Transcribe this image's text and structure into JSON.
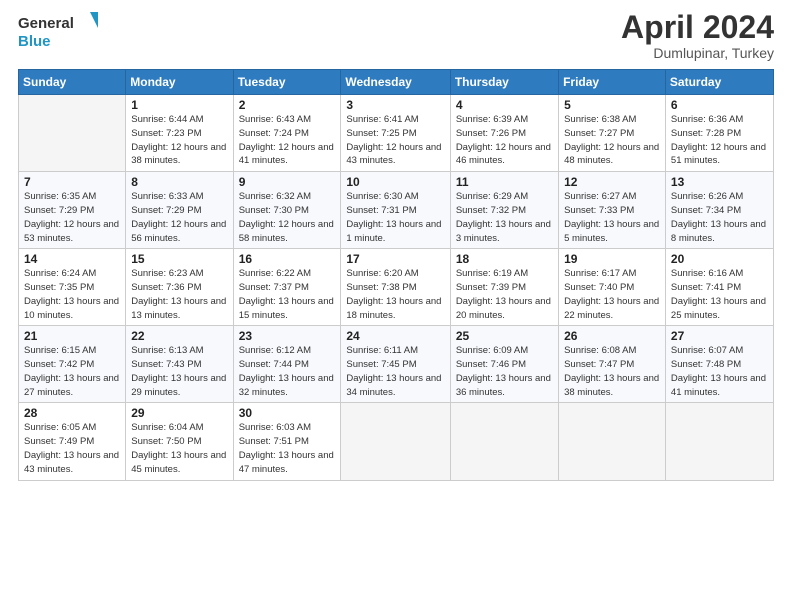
{
  "logo": {
    "line1": "General",
    "line2": "Blue"
  },
  "title": "April 2024",
  "subtitle": "Dumlupinar, Turkey",
  "headers": [
    "Sunday",
    "Monday",
    "Tuesday",
    "Wednesday",
    "Thursday",
    "Friday",
    "Saturday"
  ],
  "weeks": [
    [
      {
        "day": "",
        "sunrise": "",
        "sunset": "",
        "daylight": ""
      },
      {
        "day": "1",
        "sunrise": "6:44 AM",
        "sunset": "7:23 PM",
        "daylight": "12 hours and 38 minutes."
      },
      {
        "day": "2",
        "sunrise": "6:43 AM",
        "sunset": "7:24 PM",
        "daylight": "12 hours and 41 minutes."
      },
      {
        "day": "3",
        "sunrise": "6:41 AM",
        "sunset": "7:25 PM",
        "daylight": "12 hours and 43 minutes."
      },
      {
        "day": "4",
        "sunrise": "6:39 AM",
        "sunset": "7:26 PM",
        "daylight": "12 hours and 46 minutes."
      },
      {
        "day": "5",
        "sunrise": "6:38 AM",
        "sunset": "7:27 PM",
        "daylight": "12 hours and 48 minutes."
      },
      {
        "day": "6",
        "sunrise": "6:36 AM",
        "sunset": "7:28 PM",
        "daylight": "12 hours and 51 minutes."
      }
    ],
    [
      {
        "day": "7",
        "sunrise": "6:35 AM",
        "sunset": "7:29 PM",
        "daylight": "12 hours and 53 minutes."
      },
      {
        "day": "8",
        "sunrise": "6:33 AM",
        "sunset": "7:29 PM",
        "daylight": "12 hours and 56 minutes."
      },
      {
        "day": "9",
        "sunrise": "6:32 AM",
        "sunset": "7:30 PM",
        "daylight": "12 hours and 58 minutes."
      },
      {
        "day": "10",
        "sunrise": "6:30 AM",
        "sunset": "7:31 PM",
        "daylight": "13 hours and 1 minute."
      },
      {
        "day": "11",
        "sunrise": "6:29 AM",
        "sunset": "7:32 PM",
        "daylight": "13 hours and 3 minutes."
      },
      {
        "day": "12",
        "sunrise": "6:27 AM",
        "sunset": "7:33 PM",
        "daylight": "13 hours and 5 minutes."
      },
      {
        "day": "13",
        "sunrise": "6:26 AM",
        "sunset": "7:34 PM",
        "daylight": "13 hours and 8 minutes."
      }
    ],
    [
      {
        "day": "14",
        "sunrise": "6:24 AM",
        "sunset": "7:35 PM",
        "daylight": "13 hours and 10 minutes."
      },
      {
        "day": "15",
        "sunrise": "6:23 AM",
        "sunset": "7:36 PM",
        "daylight": "13 hours and 13 minutes."
      },
      {
        "day": "16",
        "sunrise": "6:22 AM",
        "sunset": "7:37 PM",
        "daylight": "13 hours and 15 minutes."
      },
      {
        "day": "17",
        "sunrise": "6:20 AM",
        "sunset": "7:38 PM",
        "daylight": "13 hours and 18 minutes."
      },
      {
        "day": "18",
        "sunrise": "6:19 AM",
        "sunset": "7:39 PM",
        "daylight": "13 hours and 20 minutes."
      },
      {
        "day": "19",
        "sunrise": "6:17 AM",
        "sunset": "7:40 PM",
        "daylight": "13 hours and 22 minutes."
      },
      {
        "day": "20",
        "sunrise": "6:16 AM",
        "sunset": "7:41 PM",
        "daylight": "13 hours and 25 minutes."
      }
    ],
    [
      {
        "day": "21",
        "sunrise": "6:15 AM",
        "sunset": "7:42 PM",
        "daylight": "13 hours and 27 minutes."
      },
      {
        "day": "22",
        "sunrise": "6:13 AM",
        "sunset": "7:43 PM",
        "daylight": "13 hours and 29 minutes."
      },
      {
        "day": "23",
        "sunrise": "6:12 AM",
        "sunset": "7:44 PM",
        "daylight": "13 hours and 32 minutes."
      },
      {
        "day": "24",
        "sunrise": "6:11 AM",
        "sunset": "7:45 PM",
        "daylight": "13 hours and 34 minutes."
      },
      {
        "day": "25",
        "sunrise": "6:09 AM",
        "sunset": "7:46 PM",
        "daylight": "13 hours and 36 minutes."
      },
      {
        "day": "26",
        "sunrise": "6:08 AM",
        "sunset": "7:47 PM",
        "daylight": "13 hours and 38 minutes."
      },
      {
        "day": "27",
        "sunrise": "6:07 AM",
        "sunset": "7:48 PM",
        "daylight": "13 hours and 41 minutes."
      }
    ],
    [
      {
        "day": "28",
        "sunrise": "6:05 AM",
        "sunset": "7:49 PM",
        "daylight": "13 hours and 43 minutes."
      },
      {
        "day": "29",
        "sunrise": "6:04 AM",
        "sunset": "7:50 PM",
        "daylight": "13 hours and 45 minutes."
      },
      {
        "day": "30",
        "sunrise": "6:03 AM",
        "sunset": "7:51 PM",
        "daylight": "13 hours and 47 minutes."
      },
      {
        "day": "",
        "sunrise": "",
        "sunset": "",
        "daylight": ""
      },
      {
        "day": "",
        "sunrise": "",
        "sunset": "",
        "daylight": ""
      },
      {
        "day": "",
        "sunrise": "",
        "sunset": "",
        "daylight": ""
      },
      {
        "day": "",
        "sunrise": "",
        "sunset": "",
        "daylight": ""
      }
    ]
  ],
  "labels": {
    "sunrise": "Sunrise:",
    "sunset": "Sunset:",
    "daylight": "Daylight:"
  }
}
